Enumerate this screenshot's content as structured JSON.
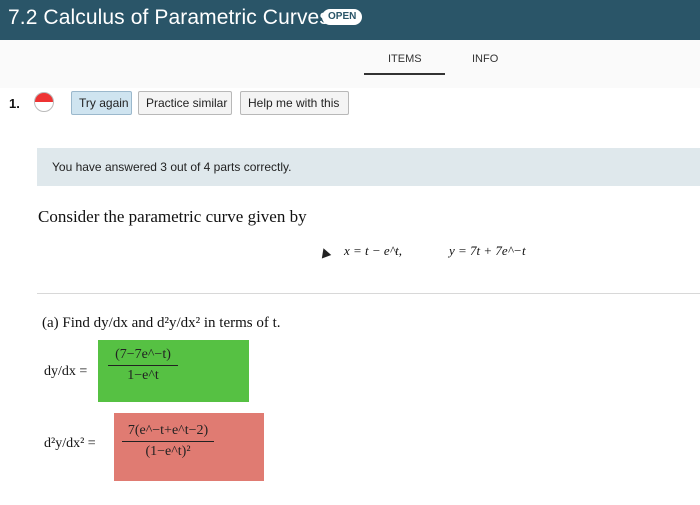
{
  "header": {
    "title": "7.2 Calculus of Parametric Curves",
    "badge": "OPEN"
  },
  "tabs": {
    "items": "ITEMS",
    "info": "INFO"
  },
  "question": {
    "number": "1.",
    "buttons": {
      "try_again": "Try again",
      "practice_similar": "Practice similar",
      "help_me": "Help me with this"
    },
    "banner": "You have answered 3 out of 4 parts correctly.",
    "prompt": "Consider the parametric curve given by",
    "equations": {
      "x": "x = t − e^t,",
      "y": "y = 7t + 7e^−t"
    },
    "part_a": "(a) Find dy/dx and d²y/dx² in terms of t.",
    "dy_label": "dy/dx =",
    "d2_label": "d²y/dx² =",
    "dy_answer": {
      "num": "(7−7e^−t)",
      "den": "1−e^t",
      "status": "correct"
    },
    "d2_answer": {
      "num": "7(e^−t+e^t−2)",
      "den": "(1−e^t)²",
      "status": "incorrect"
    }
  },
  "colors": {
    "header": "#2a5568",
    "correct": "#56c143",
    "incorrect": "#e07b72",
    "banner": "#dfe8ec"
  }
}
